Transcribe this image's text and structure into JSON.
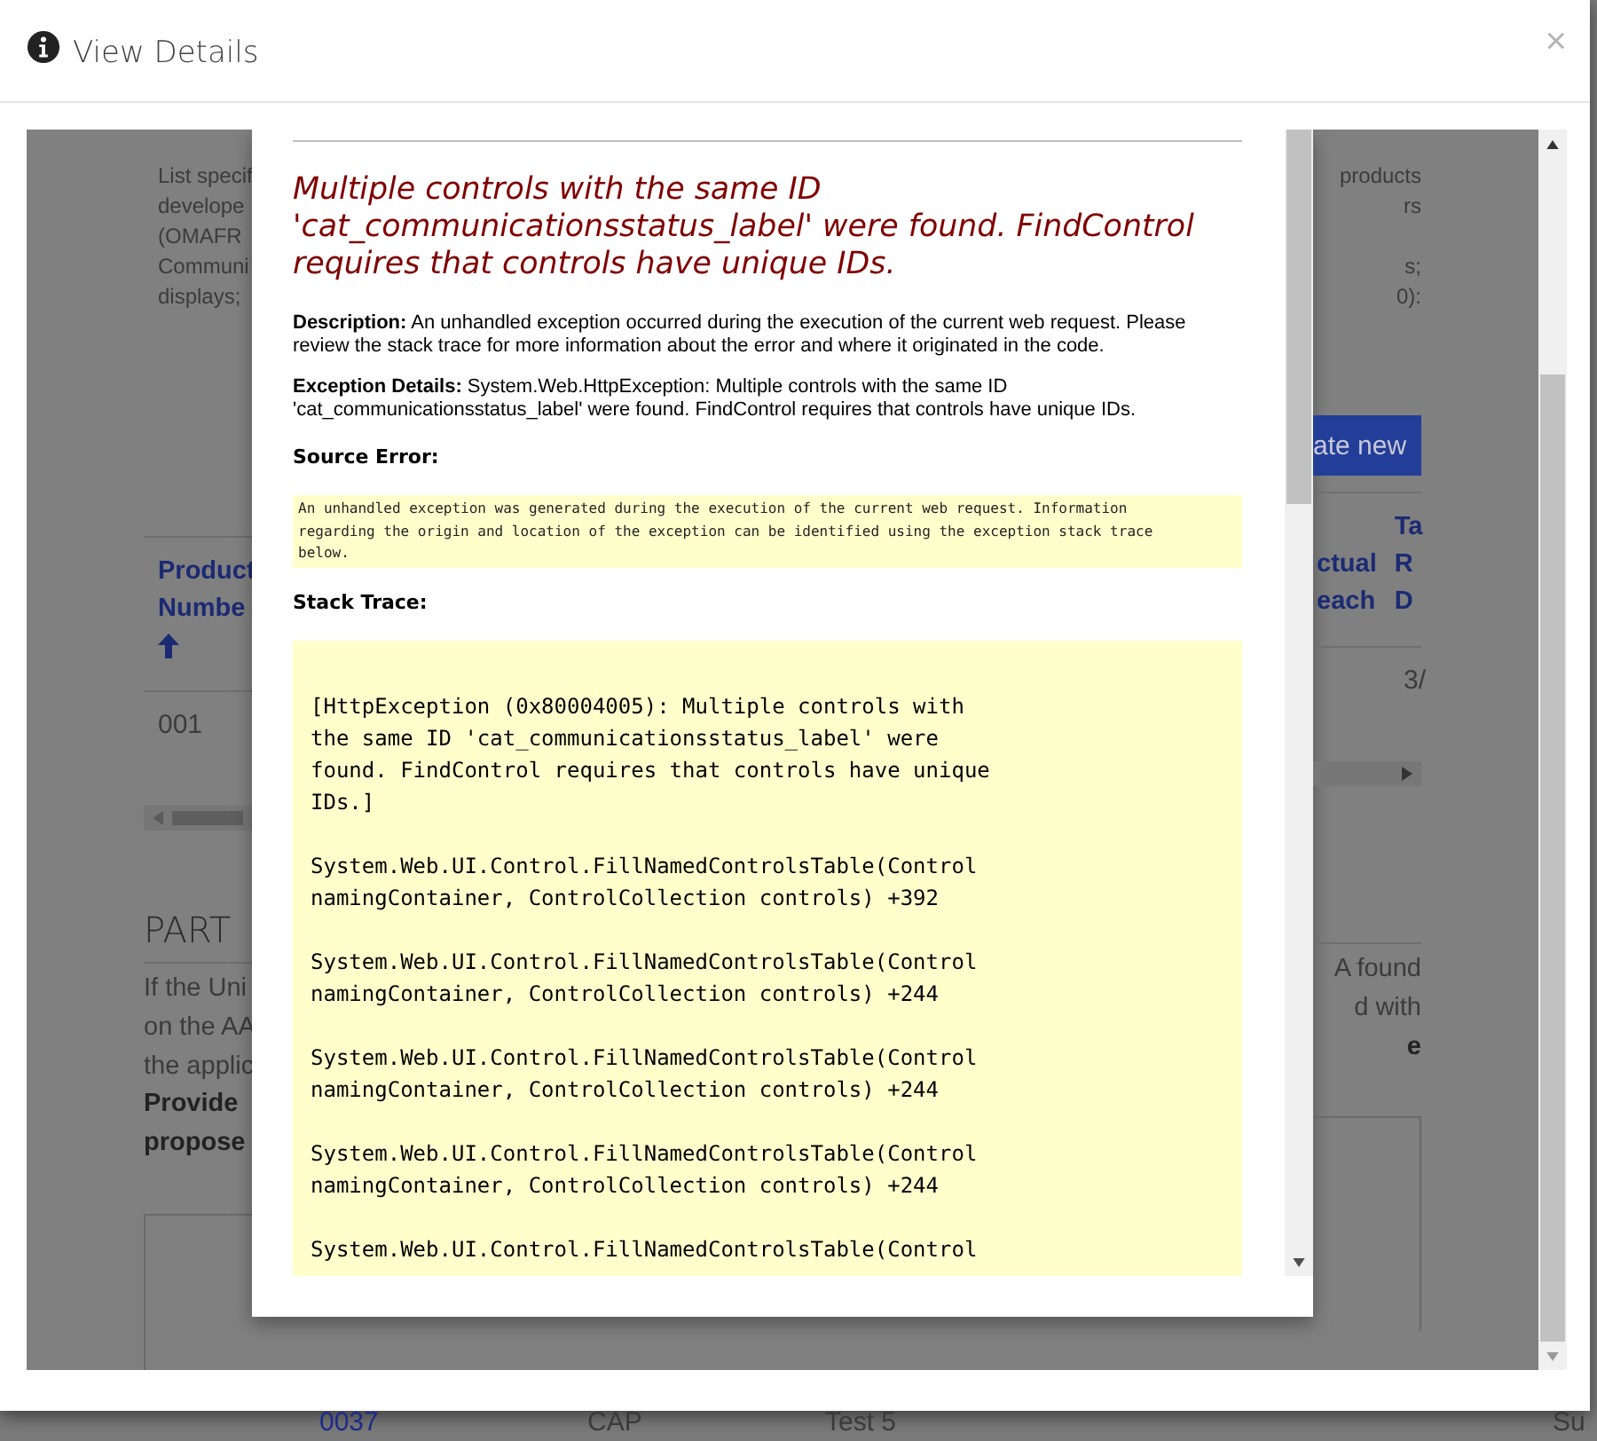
{
  "dialog": {
    "title": "View Details",
    "close": "×"
  },
  "background": {
    "left": {
      "paragraph": [
        "List specif",
        "develope",
        "(OMAFR",
        "Communi",
        "displays;"
      ],
      "header": [
        "Product",
        "Numbe"
      ],
      "cell": "001",
      "section_title": "PART",
      "section_text": [
        "If the Uni",
        "on the AA",
        "the applic"
      ],
      "section_bold": [
        "Provide",
        "propose"
      ]
    },
    "right": {
      "paragraph": [
        [
          "products",
          "rs"
        ],
        [
          "s;",
          "0):"
        ]
      ],
      "button": "ate new",
      "header_1": [
        "ctual",
        "each"
      ],
      "header_2": [
        "Ta",
        "R",
        "D"
      ],
      "cell": "3/",
      "section_text": [
        "A found",
        "d with"
      ],
      "section_bold": [
        "e"
      ]
    },
    "below": [
      "0037",
      "CAP",
      "Test 5",
      "Su"
    ]
  },
  "error_page": {
    "title": "Multiple controls with the same ID 'cat_communicationsstatus_label' were found. FindControl requires that controls have unique IDs.",
    "description": "**Description:** An unhandled exception occurred during the execution of the current web request. Please review the stack trace for more information about the error and where it originated in the code.",
    "exception_details": "**Exception Details:** System.Web.HttpException: Multiple controls with the same ID 'cat_communicationsstatus_label' were found. FindControl requires that controls have unique IDs.",
    "source_error_heading": "Source Error:",
    "source_error": [
      "An unhandled exception was generated during the execution of the current web request. Information",
      "regarding the origin and location of the exception can be identified using the exception stack trace",
      "below."
    ],
    "stack_trace_heading": "Stack Trace:",
    "stack_trace": [
      [
        "[HttpException (0x80004005): Multiple controls with",
        "the same ID 'cat_communicationsstatus_label' were",
        "found. FindControl requires that controls have unique",
        "IDs.]"
      ],
      [
        "System.Web.UI.Control.FillNamedControlsTable(Control",
        "namingContainer, ControlCollection controls) +392"
      ],
      [
        "System.Web.UI.Control.FillNamedControlsTable(Control",
        "namingContainer, ControlCollection controls) +244"
      ],
      [
        "System.Web.UI.Control.FillNamedControlsTable(Control",
        "namingContainer, ControlCollection controls) +244"
      ],
      [
        "System.Web.UI.Control.FillNamedControlsTable(Control",
        "namingContainer, ControlCollection controls) +244"
      ],
      [
        "System.Web.UI.Control.FillNamedControlsTable(Control"
      ]
    ]
  }
}
